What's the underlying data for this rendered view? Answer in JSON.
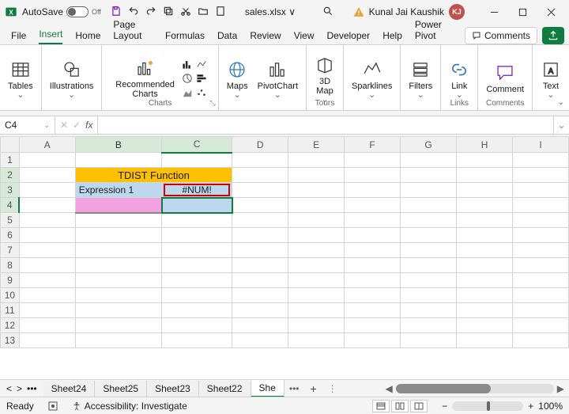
{
  "titlebar": {
    "autosave_label": "AutoSave",
    "autosave_state": "Off",
    "filename": "sales.xlsx ∨",
    "user_name": "Kunal Jai Kaushik",
    "user_initials": "KJ"
  },
  "tabs": {
    "items": [
      "File",
      "Insert",
      "Home",
      "Page Layout",
      "Formulas",
      "Data",
      "Review",
      "View",
      "Developer",
      "Help",
      "Power Pivot"
    ],
    "active_index": 1,
    "comments_label": "Comments"
  },
  "ribbon": {
    "tables": "Tables",
    "illustrations": "Illustrations",
    "rec_charts": "Recommended\nCharts",
    "charts_label": "Charts",
    "maps": "Maps",
    "pivotchart": "PivotChart",
    "map3d": "3D\nMap",
    "tours_label": "Tours",
    "sparklines": "Sparklines",
    "filters": "Filters",
    "link": "Link",
    "links_label": "Links",
    "comment": "Comment",
    "comments_label": "Comments",
    "text": "Text"
  },
  "namebox": "C4",
  "cells": {
    "b2c2": "TDIST Function",
    "b3": "Expression 1",
    "c3": "#NUM!"
  },
  "columns": [
    "A",
    "B",
    "C",
    "D",
    "E",
    "F",
    "G",
    "H",
    "I"
  ],
  "sheet_tabs": [
    "Sheet24",
    "Sheet25",
    "Sheet23",
    "Sheet22"
  ],
  "active_sheet_partial": "She",
  "status": {
    "ready": "Ready",
    "access": "Accessibility: Investigate",
    "zoom": "100%"
  }
}
